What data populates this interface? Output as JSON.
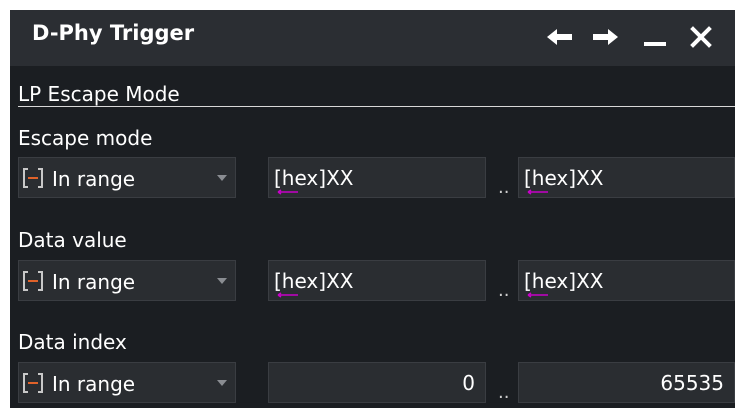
{
  "dialog": {
    "title": "D-Phy Trigger",
    "controls": {
      "back_icon": "arrow-left-icon",
      "forward_icon": "arrow-right-icon",
      "minimize_icon": "minimize-icon",
      "close_icon": "close-icon"
    }
  },
  "section": {
    "title": "LP Escape Mode"
  },
  "fields": {
    "escape_mode": {
      "label": "Escape mode",
      "condition": "In range",
      "from": "[hex]XX",
      "separator": "..",
      "to": "[hex]XX"
    },
    "data_value": {
      "label": "Data value",
      "condition": "In range",
      "from": "[hex]XX",
      "separator": "..",
      "to": "[hex]XX"
    },
    "data_index": {
      "label": "Data index",
      "condition": "In range",
      "from": "0",
      "separator": "..",
      "to": "65535"
    }
  },
  "colors": {
    "background": "#1b1e22",
    "titlebar": "#2b2e33",
    "input_bg": "#2a2d31",
    "range_icon_accent": "#e0622a",
    "hex_underline": "#c800c8"
  }
}
